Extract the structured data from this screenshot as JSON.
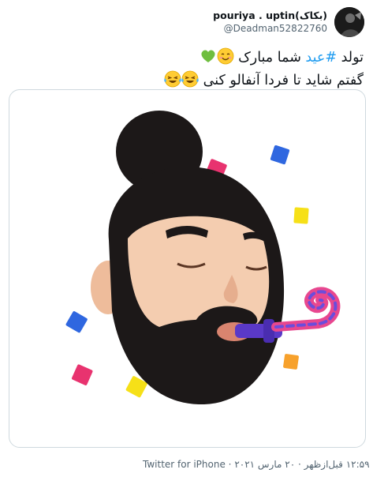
{
  "user": {
    "display_name": "pouriya . uptin(بکاک)",
    "handle": "@Deadman52822760"
  },
  "tweet": {
    "line1_before": "تولد ",
    "hashtag": "#عید",
    "line1_after": " شما مبارک ",
    "line2": "گفتم شاید تا فردا آنفالو کنی ",
    "emoji": [
      "smiling-face-icon",
      "green-heart-icon",
      "tears-of-joy-icon"
    ]
  },
  "media": {
    "subject": "memoji-party-blower-icon"
  },
  "meta": {
    "time": "۱۲:۵۹ قبل‌ازظهر",
    "date": "۲۰ مارس ۲۰۲۱",
    "source": "Twitter for iPhone",
    "separator": " · "
  },
  "colors": {
    "hashtag": "#1d9bf0",
    "border": "#cfd9de",
    "secondary_text": "#536471",
    "beard": "#1c1818",
    "skin": "#f4cdb0",
    "blower": "#5a39c8",
    "blower_spiral": "#e8478f"
  }
}
